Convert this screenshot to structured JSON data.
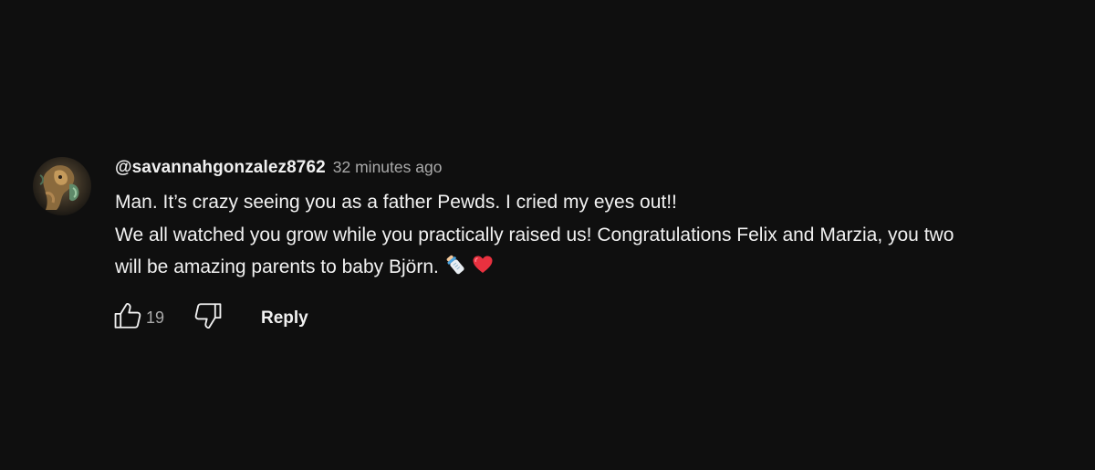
{
  "comment": {
    "author": "@savannahgonzalez8762",
    "timestamp": "32 minutes ago",
    "lines": [
      "Man. It’s crazy seeing you as a father Pewds. I cried my eyes out!!",
      "We all watched you grow while you practically raised us! Congratulations Felix and Marzia, you two",
      "will be amazing parents to baby Björn."
    ],
    "emojis": [
      "baby-bottle",
      "red-heart"
    ],
    "avatar_icon": "profile-avatar",
    "like_count": "19",
    "like_icon": "thumbs-up-icon",
    "dislike_icon": "thumbs-down-icon",
    "reply_label": "Reply"
  },
  "colors": {
    "background": "#0f0f0f",
    "primary_text": "#f1f1f1",
    "secondary_text": "#aaaaaa",
    "heart": "#e8313f"
  }
}
